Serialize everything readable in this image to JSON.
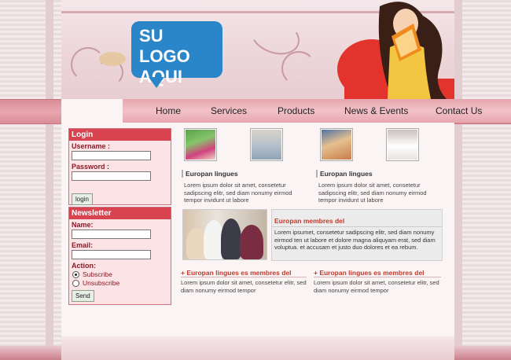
{
  "header": {
    "logo_line1": "SU LOGO",
    "logo_line2": "AQUI"
  },
  "nav": {
    "items": [
      "Home",
      "Services",
      "Products",
      "News & Events",
      "Contact Us"
    ]
  },
  "login": {
    "title": "Login",
    "username_label": "Username :",
    "password_label": "Password :",
    "button": "login"
  },
  "newsletter": {
    "title": "Newsletter",
    "name_label": "Name:",
    "email_label": "Email:",
    "action_label": "Action:",
    "subscribe": "Subscribe",
    "unsubscribe": "Unsubscribe",
    "button": "Send"
  },
  "content": {
    "block1_title": "Europan lingues",
    "block1_text": "Lorem ipsum dolor sit amet, consetetur sadipscing elitr, sed diam nonumy eirmod tempor invidunt ut labore",
    "block2_title": "Europan lingues",
    "block2_text": "Lorem ipsum dolor sit amet, consetetur sadipscing elitr, sed diam nonumy eirmod tempor invidunt ut labore",
    "membres_title": "Europan membres del",
    "membres_text": "Lorem ipsumet, consetetur sadipscing elitr, sed diam nonumy eirmod ten ut labore et dolore magna aliquyam erat, sed diam voluptua. et accusam et justo duo dolores et ea rebum.",
    "bottom1_title": "+ Europan lingues es membres del",
    "bottom1_text": "Lorem ipsum dolor sit amet, consetetur elitr, sed diam nonumy eirmod tempor",
    "bottom2_title": "+ Europan lingues es membres del",
    "bottom2_text": "Lorem ipsum dolor sit amet, consetetur elitr, sed diam nonumy eirmod tempor"
  },
  "colors": {
    "accent": "#d7434f",
    "logo_blue": "#2a86c9",
    "heading_red": "#c0392b",
    "nav_pink": "#e7a5ae"
  }
}
